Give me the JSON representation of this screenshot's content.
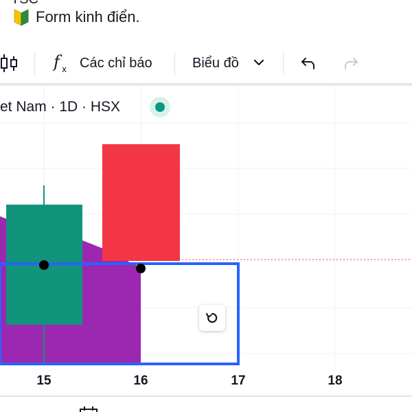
{
  "post": {
    "top_cut_text": "TSC",
    "text": "Form kinh điển."
  },
  "toolbar": {
    "indicators_label": "Các chỉ báo",
    "chart_label": "Biểu đồ"
  },
  "legend": {
    "symbol_info": "et Nam · 1D · HSX",
    "market_status": "open"
  },
  "colors": {
    "bullish": "#12937c",
    "bearish": "#f23645",
    "area_fill": "#9c27b0",
    "selection": "#2962ff",
    "status_dot": "#089981"
  },
  "chart_data": {
    "type": "candlestick",
    "x_ticks": [
      "15",
      "16",
      "17",
      "18"
    ],
    "candles": [
      {
        "x": 15,
        "color": "green"
      },
      {
        "x": 16,
        "color": "red"
      }
    ]
  }
}
